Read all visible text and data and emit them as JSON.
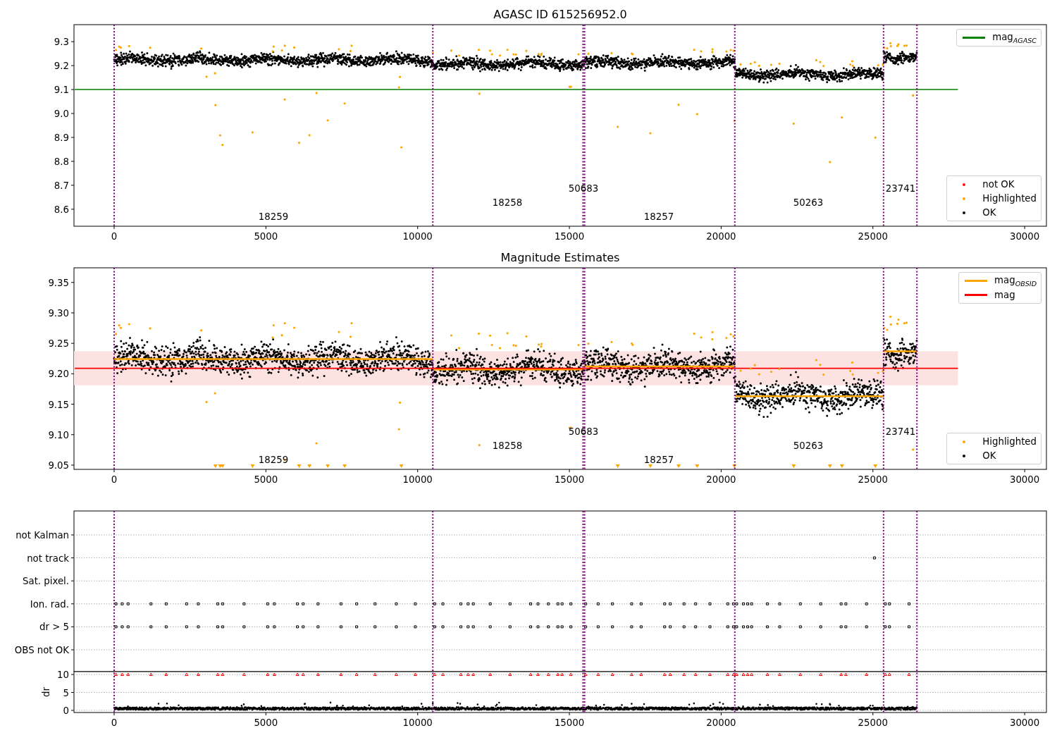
{
  "panels": [
    {
      "kind": "magnitude",
      "point_legend": [
        {
          "kind": "not_ok",
          "label": "not OK",
          "color": "#ff0000"
        },
        {
          "kind": "highlighted",
          "label": "Highlighted",
          "color": "#ffa500"
        },
        {
          "kind": "ok",
          "label": "OK",
          "color": "#000000"
        }
      ],
      "chart_data": {
        "type": "line",
        "title": "AGASC ID 615256952.0",
        "x": [
          -1300,
          27800
        ],
        "series": [
          {
            "name": "mag$_{AGASC}$",
            "color": "#008000",
            "values": [
              9.1,
              9.1
            ]
          }
        ],
        "xlim": [
          -1323,
          30717
        ],
        "ylim": [
          8.529,
          9.371
        ],
        "xticks": [
          {
            "value": 0,
            "label": "0"
          },
          {
            "value": 5000,
            "label": "5000"
          },
          {
            "value": 10000,
            "label": "10000"
          },
          {
            "value": 15000,
            "label": "15000"
          },
          {
            "value": 20000,
            "label": "20000"
          },
          {
            "value": 25000,
            "label": "25000"
          },
          {
            "value": 30000,
            "label": "30000"
          }
        ],
        "yticks": [
          {
            "value": 8.6,
            "label": "8.6"
          },
          {
            "value": 8.7,
            "label": "8.7"
          },
          {
            "value": 8.8,
            "label": "8.8"
          },
          {
            "value": 8.9,
            "label": "8.9"
          },
          {
            "value": 9.0,
            "label": "9.0"
          },
          {
            "value": 9.1,
            "label": "9.1"
          },
          {
            "value": 9.2,
            "label": "9.2"
          },
          {
            "value": 9.3,
            "label": "9.3"
          }
        ],
        "ref_lines": [
          {
            "axis": "x",
            "value": 0,
            "color": "#800080"
          },
          {
            "axis": "x",
            "value": 10500,
            "color": "#800080"
          },
          {
            "axis": "x",
            "value": 15450,
            "color": "#800080"
          },
          {
            "axis": "x",
            "value": 15500,
            "color": "#800080"
          },
          {
            "axis": "x",
            "value": 20450,
            "color": "#800080"
          },
          {
            "axis": "x",
            "value": 25350,
            "color": "#800080"
          },
          {
            "axis": "x",
            "value": 26450,
            "color": "#800080"
          }
        ],
        "annotations": [
          "18259",
          "18258",
          "50683",
          "18257",
          "50263",
          "23741"
        ]
      }
    },
    {
      "kind": "magnitude",
      "point_legend": [
        {
          "kind": "highlighted",
          "label": "Highlighted",
          "color": "#ffa500"
        },
        {
          "kind": "ok",
          "label": "OK",
          "color": "#000000"
        }
      ],
      "chart_data": {
        "type": "line",
        "title": "Magnitude Estimates",
        "x": [
          -1300,
          0,
          10500,
          10500,
          15470,
          15470,
          20450,
          20450,
          25350,
          25350,
          26450,
          27800
        ],
        "series": [
          {
            "name": "mag$_{OBSID}$",
            "color": "#ffa500",
            "values": [
              null,
              9.224,
              9.224,
              9.207,
              9.207,
              9.212,
              9.212,
              9.163,
              9.163,
              9.237,
              9.237,
              null
            ]
          },
          {
            "name": "mag",
            "color": "#ff0000",
            "values": [
              9.209,
              9.209,
              9.209,
              9.209,
              9.209,
              9.209,
              9.209,
              9.209,
              9.209,
              9.209,
              9.209,
              9.209
            ]
          }
        ],
        "xlim": [
          -1323,
          30717
        ],
        "ylim": [
          9.043,
          9.374
        ],
        "xticks": [
          {
            "value": 0,
            "label": "0"
          },
          {
            "value": 5000,
            "label": "5000"
          },
          {
            "value": 10000,
            "label": "10000"
          },
          {
            "value": 15000,
            "label": "15000"
          },
          {
            "value": 20000,
            "label": "20000"
          },
          {
            "value": 25000,
            "label": "25000"
          },
          {
            "value": 30000,
            "label": "30000"
          }
        ],
        "yticks": [
          {
            "value": 9.05,
            "label": "9.05"
          },
          {
            "value": 9.1,
            "label": "9.10"
          },
          {
            "value": 9.15,
            "label": "9.15"
          },
          {
            "value": 9.2,
            "label": "9.20"
          },
          {
            "value": 9.25,
            "label": "9.25"
          },
          {
            "value": 9.3,
            "label": "9.30"
          },
          {
            "value": 9.35,
            "label": "9.35"
          }
        ],
        "bands": [
          {
            "axis": "y",
            "from": 9.181,
            "to": 9.237,
            "color": "#fde2e2"
          }
        ],
        "ref_lines": [
          {
            "axis": "x",
            "value": 0,
            "color": "#800080"
          },
          {
            "axis": "x",
            "value": 10500,
            "color": "#800080"
          },
          {
            "axis": "x",
            "value": 15450,
            "color": "#800080"
          },
          {
            "axis": "x",
            "value": 15500,
            "color": "#800080"
          },
          {
            "axis": "x",
            "value": 20450,
            "color": "#800080"
          },
          {
            "axis": "x",
            "value": 25350,
            "color": "#800080"
          },
          {
            "axis": "x",
            "value": 26450,
            "color": "#800080"
          }
        ],
        "annotations": [
          "18259",
          "18258",
          "50683",
          "18257",
          "50263",
          "23741"
        ]
      }
    },
    {
      "kind": "flags",
      "flag_rows": [
        {
          "label": "not Kalman",
          "kind": "none"
        },
        {
          "label": "not track",
          "kind": "single"
        },
        {
          "label": "Sat. pixel.",
          "kind": "none"
        },
        {
          "label": "Ion. rad.",
          "kind": "frequent"
        },
        {
          "label": "dr > 5",
          "kind": "frequent"
        },
        {
          "label": "OBS not OK",
          "kind": "none"
        }
      ],
      "chart_data": {
        "type": "scatter",
        "ylabel": "dr",
        "xlim": [
          -1323,
          30717
        ],
        "ylim": [
          -0.6,
          10.8
        ],
        "grid": true,
        "xticks": [
          {
            "value": 0,
            "label": "0"
          },
          {
            "value": 5000,
            "label": "5000"
          },
          {
            "value": 10000,
            "label": "10000"
          },
          {
            "value": 15000,
            "label": "15000"
          },
          {
            "value": 20000,
            "label": "20000"
          },
          {
            "value": 25000,
            "label": "25000"
          },
          {
            "value": 30000,
            "label": "30000"
          }
        ],
        "yticks": [
          {
            "value": 0,
            "label": "0"
          },
          {
            "value": 5,
            "label": "5"
          },
          {
            "value": 10,
            "label": "10"
          }
        ],
        "ref_lines": [
          {
            "axis": "x",
            "value": 0,
            "color": "#800080"
          },
          {
            "axis": "x",
            "value": 10500,
            "color": "#800080"
          },
          {
            "axis": "x",
            "value": 15450,
            "color": "#800080"
          },
          {
            "axis": "x",
            "value": 15500,
            "color": "#800080"
          },
          {
            "axis": "x",
            "value": 20450,
            "color": "#800080"
          },
          {
            "axis": "x",
            "value": 25350,
            "color": "#800080"
          },
          {
            "axis": "x",
            "value": 26450,
            "color": "#800080"
          }
        ]
      }
    }
  ]
}
